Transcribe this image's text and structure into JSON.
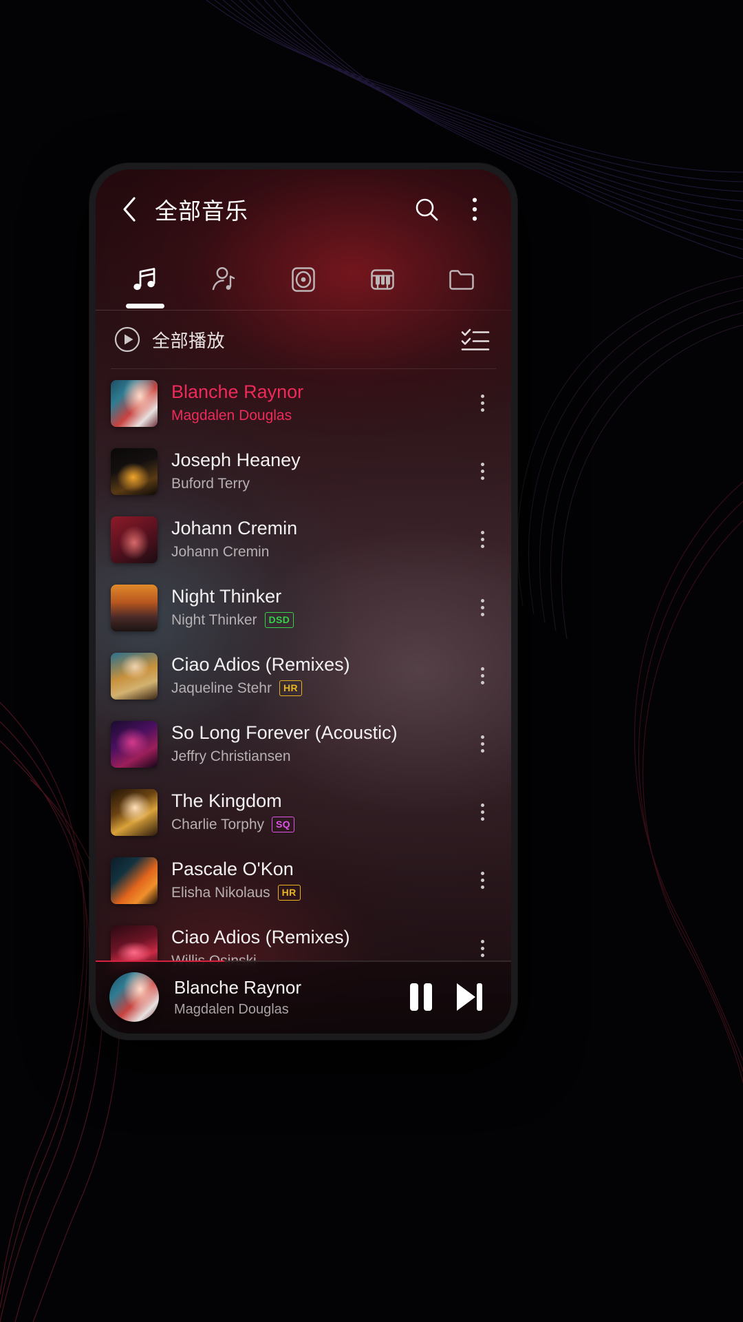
{
  "app": {
    "header": {
      "title": "全部音乐",
      "back_icon": "chevron-left-icon",
      "search_icon": "search-icon",
      "overflow_icon": "more-vertical-icon"
    },
    "tabs": [
      {
        "name": "songs",
        "icon": "music-note-icon",
        "active": true
      },
      {
        "name": "artists",
        "icon": "artist-person-icon",
        "active": false
      },
      {
        "name": "albums",
        "icon": "album-disc-icon",
        "active": false
      },
      {
        "name": "genres",
        "icon": "piano-keys-icon",
        "active": false
      },
      {
        "name": "folders",
        "icon": "folder-icon",
        "active": false
      }
    ],
    "play_all": {
      "label": "全部播放",
      "play_icon": "play-circle-icon",
      "multiselect_icon": "checklist-icon"
    },
    "songs": [
      {
        "title": "Blanche Raynor",
        "artist": "Magdalen Douglas",
        "badge": "",
        "playing": true,
        "art": "ph1"
      },
      {
        "title": "Joseph Heaney",
        "artist": "Buford Terry",
        "badge": "",
        "playing": false,
        "art": "ph2"
      },
      {
        "title": "Johann Cremin",
        "artist": "Johann Cremin",
        "badge": "",
        "playing": false,
        "art": "ph3"
      },
      {
        "title": "Night Thinker",
        "artist": "Night Thinker",
        "badge": "DSD",
        "playing": false,
        "art": "ph4"
      },
      {
        "title": "Ciao Adios (Remixes)",
        "artist": "Jaqueline Stehr",
        "badge": "HR",
        "playing": false,
        "art": "ph5"
      },
      {
        "title": "So Long Forever (Acoustic)",
        "artist": "Jeffry Christiansen",
        "badge": "",
        "playing": false,
        "art": "ph6"
      },
      {
        "title": "The Kingdom",
        "artist": "Charlie Torphy",
        "badge": "SQ",
        "playing": false,
        "art": "ph7"
      },
      {
        "title": "Pascale O'Kon",
        "artist": "Elisha Nikolaus",
        "badge": "HR",
        "playing": false,
        "art": "ph8"
      },
      {
        "title": "Ciao Adios (Remixes)",
        "artist": "Willis Osinski",
        "badge": "",
        "playing": false,
        "art": "ph9"
      }
    ],
    "now_playing": {
      "title": "Blanche Raynor",
      "artist": "Magdalen Douglas",
      "pause_icon": "pause-icon",
      "next_icon": "skip-next-icon",
      "progress_percent": 31,
      "art": "ph1"
    },
    "colors": {
      "accent_playing": "#ef2a5a",
      "badge_dsd": "#37d24a",
      "badge_hr": "#e8b520",
      "badge_sq": "#e052e8",
      "progress": "#d8203f"
    }
  }
}
